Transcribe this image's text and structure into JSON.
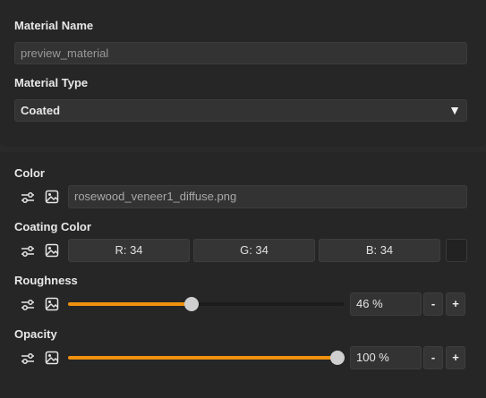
{
  "material": {
    "name_label": "Material Name",
    "name_value": "preview_material",
    "type_label": "Material Type",
    "type_value": "Coated"
  },
  "color": {
    "label": "Color",
    "file": "rosewood_veneer1_diffuse.png"
  },
  "coating_color": {
    "label": "Coating Color",
    "r": "R: 34",
    "g": "G: 34",
    "b": "B: 34",
    "swatch": "#222222"
  },
  "roughness": {
    "label": "Roughness",
    "value": 46,
    "display": "46 %",
    "minus": "-",
    "plus": "+"
  },
  "opacity": {
    "label": "Opacity",
    "value": 100,
    "display": "100 %",
    "minus": "-",
    "plus": "+"
  },
  "icons": {
    "adjust": "sliders-icon",
    "texture": "image-icon",
    "dropdown": "triangle-down-icon"
  },
  "accent_color": "#f0920f"
}
